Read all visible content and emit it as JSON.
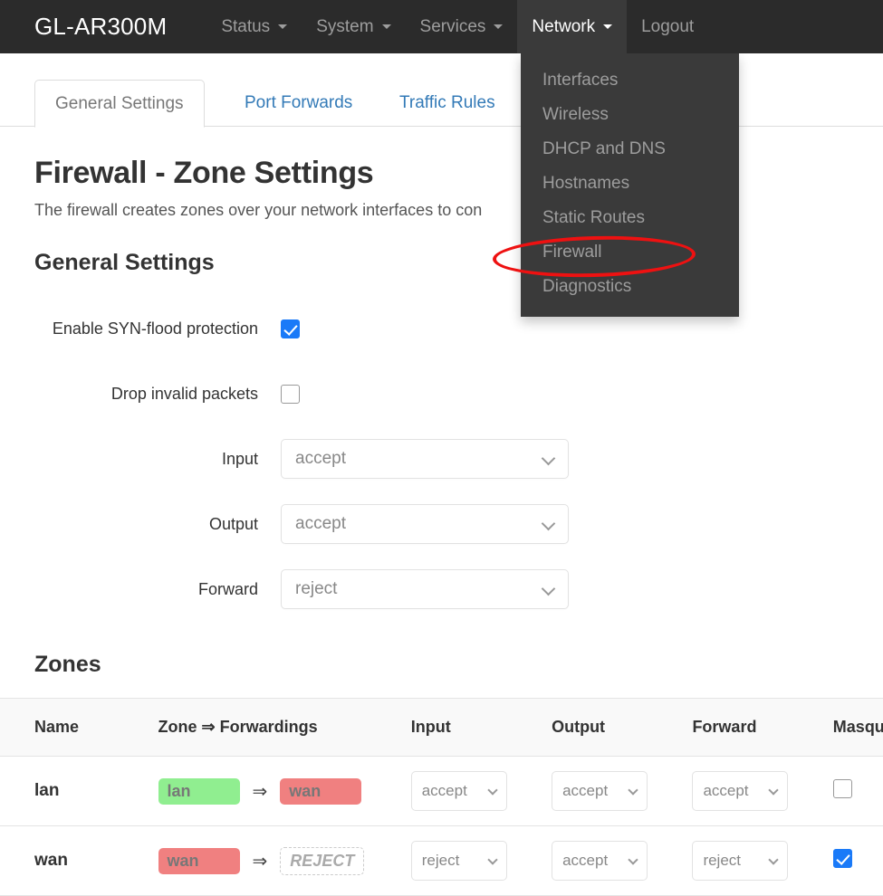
{
  "navbar": {
    "brand": "GL-AR300M",
    "items": [
      {
        "label": "Status",
        "has_caret": true,
        "active": false
      },
      {
        "label": "System",
        "has_caret": true,
        "active": false
      },
      {
        "label": "Services",
        "has_caret": true,
        "active": false
      },
      {
        "label": "Network",
        "has_caret": true,
        "active": true
      },
      {
        "label": "Logout",
        "has_caret": false,
        "active": false
      }
    ]
  },
  "dropdown": {
    "open_for": "Network",
    "items": [
      "Interfaces",
      "Wireless",
      "DHCP and DNS",
      "Hostnames",
      "Static Routes",
      "Firewall",
      "Diagnostics"
    ],
    "highlighted_item": "Firewall"
  },
  "annotation": {
    "shape": "ellipse",
    "color": "#ee1111",
    "targets": "Firewall"
  },
  "tabs": [
    {
      "label": "General Settings",
      "active": true
    },
    {
      "label": "Port Forwards",
      "active": false
    },
    {
      "label": "Traffic Rules",
      "active": false
    }
  ],
  "page": {
    "title": "Firewall - Zone Settings",
    "description": "The firewall creates zones over your network interfaces to con",
    "general_heading": "General Settings",
    "zones_heading": "Zones"
  },
  "general_settings": {
    "syn_flood": {
      "label": "Enable SYN-flood protection",
      "checked": true
    },
    "drop_invalid": {
      "label": "Drop invalid packets",
      "checked": false
    },
    "input": {
      "label": "Input",
      "value": "accept"
    },
    "output": {
      "label": "Output",
      "value": "accept"
    },
    "forward": {
      "label": "Forward",
      "value": "reject"
    }
  },
  "zones_table": {
    "columns": [
      "Name",
      "Zone ⇒ Forwardings",
      "Input",
      "Output",
      "Forward",
      "Masquerading"
    ],
    "arrow": "⇒",
    "rows": [
      {
        "name": "lan",
        "zone_badge": {
          "text": "lan",
          "style": "green"
        },
        "forward_badge": {
          "text": "wan",
          "style": "red"
        },
        "input": "accept",
        "output": "accept",
        "forward": "accept",
        "masquerading": false
      },
      {
        "name": "wan",
        "zone_badge": {
          "text": "wan",
          "style": "red"
        },
        "forward_badge": {
          "text": "REJECT",
          "style": "empty"
        },
        "input": "reject",
        "output": "accept",
        "forward": "reject",
        "masquerading": true
      }
    ]
  },
  "colors": {
    "navbar_bg": "#2b2b2b",
    "dropdown_bg": "#3a3a3a",
    "link": "#337ab7",
    "checkbox_checked": "#1a7af8",
    "zone_green": "#90ee90",
    "zone_red": "#f08080",
    "annotation_red": "#ee1111"
  }
}
